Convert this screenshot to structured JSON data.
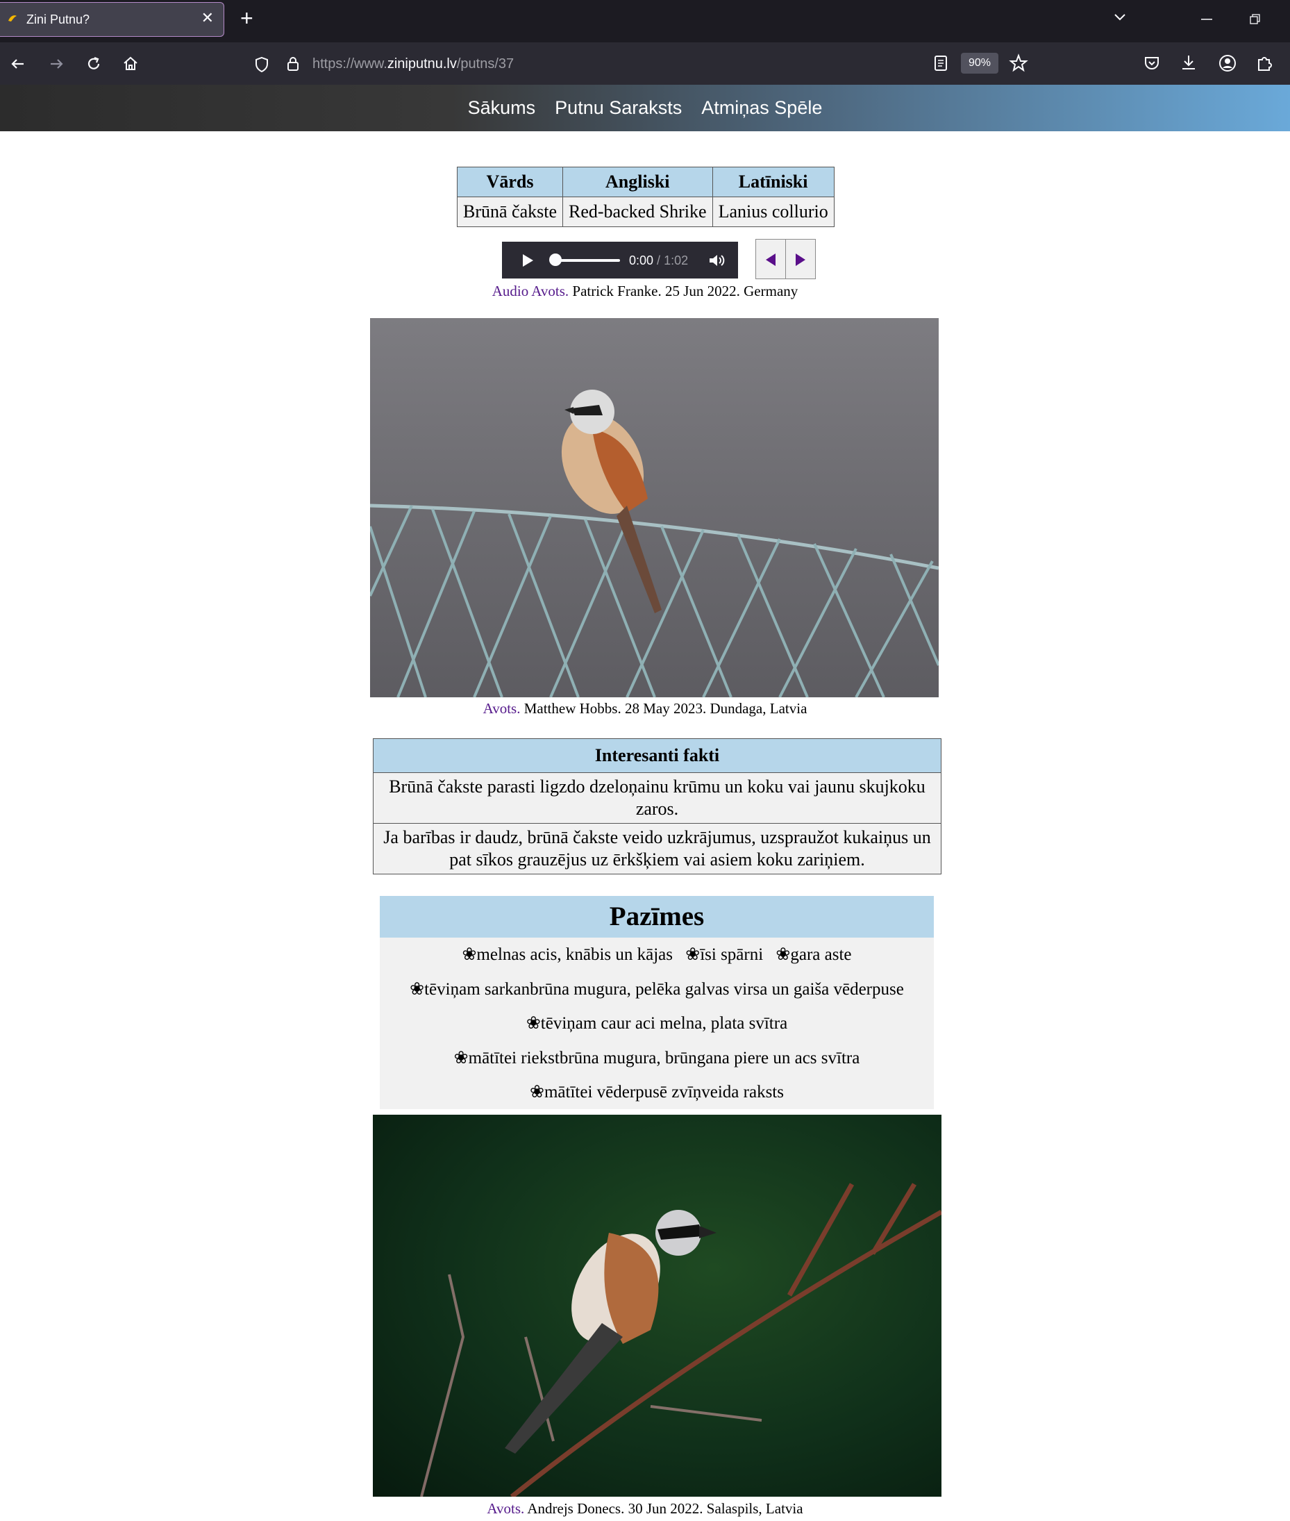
{
  "browser": {
    "tab_title": "Zini Putnu?",
    "tab_close": "✕",
    "new_tab": "+",
    "url_prefix": "https://www.",
    "url_host": "ziniputnu.lv",
    "url_path": "/putns/37",
    "zoom": "90%"
  },
  "site_nav": {
    "items": [
      "Sākums",
      "Putnu Saraksts",
      "Atmiņas Spēle"
    ]
  },
  "names_table": {
    "headers": [
      "Vārds",
      "Angliski",
      "Latīniski"
    ],
    "row": [
      "Brūnā čakste",
      "Red-backed Shrike",
      "Lanius collurio"
    ]
  },
  "audio": {
    "current": "0:00",
    "separator": " / ",
    "duration": "1:02",
    "progress": 0
  },
  "audio_credit": {
    "link": "Audio Avots.",
    "text": " Patrick Franke. 25 Jun 2022. Germany"
  },
  "photo1_credit": {
    "link": "Avots.",
    "text": " Matthew Hobbs. 28 May 2023. Dundaga, Latvia"
  },
  "facts": {
    "header": "Interesanti fakti",
    "items": [
      "Brūnā čakste parasti ligzdo dzeloņainu krūmu un koku vai jaunu skujkoku zaros.",
      "Ja barības ir daudz, brūnā čakste veido uzkrājumus, uzspraužot kukaiņus un pat sīkos grauzējus uz ērkšķiem vai asiem koku zariņiem."
    ]
  },
  "features": {
    "title": "Pazīmes",
    "row1": [
      "❀melnas acis, knābis un kājas",
      "❀īsi spārni",
      "❀gara aste"
    ],
    "row2": "❀tēviņam sarkanbrūna mugura, pelēka galvas virsa un gaiša vēderpuse",
    "row3": "❀tēviņam caur aci melna, plata svītra",
    "row4": "❀mātītei riekstbrūna mugura, brūngana piere un acs svītra",
    "row5": "❀mātītei vēderpusē zvīņveida raksts"
  },
  "photo2_credit": {
    "link": "Avots.",
    "text": " Andrejs Donecs. 30 Jun 2022. Salaspils, Latvia"
  }
}
